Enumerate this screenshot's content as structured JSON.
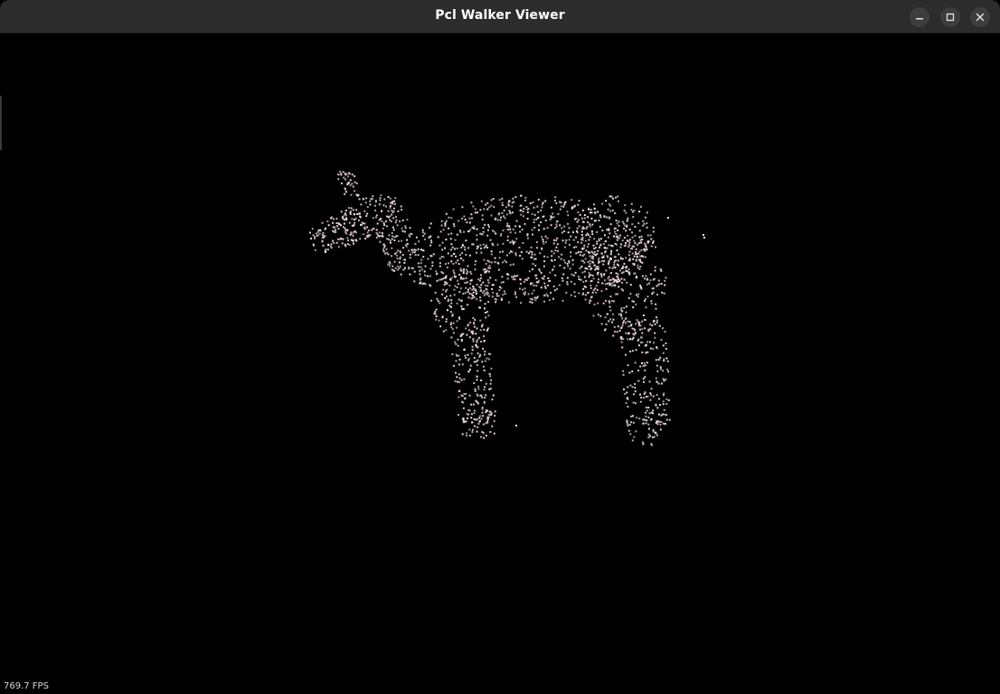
{
  "window": {
    "title": "Pcl Walker Viewer",
    "buttons": {
      "minimize": "minimize-icon",
      "maximize": "maximize-icon",
      "close": "close-icon"
    }
  },
  "viewer": {
    "background": "#000000",
    "point_color": "#f2dde2",
    "fps_label": "769.7 FPS"
  }
}
